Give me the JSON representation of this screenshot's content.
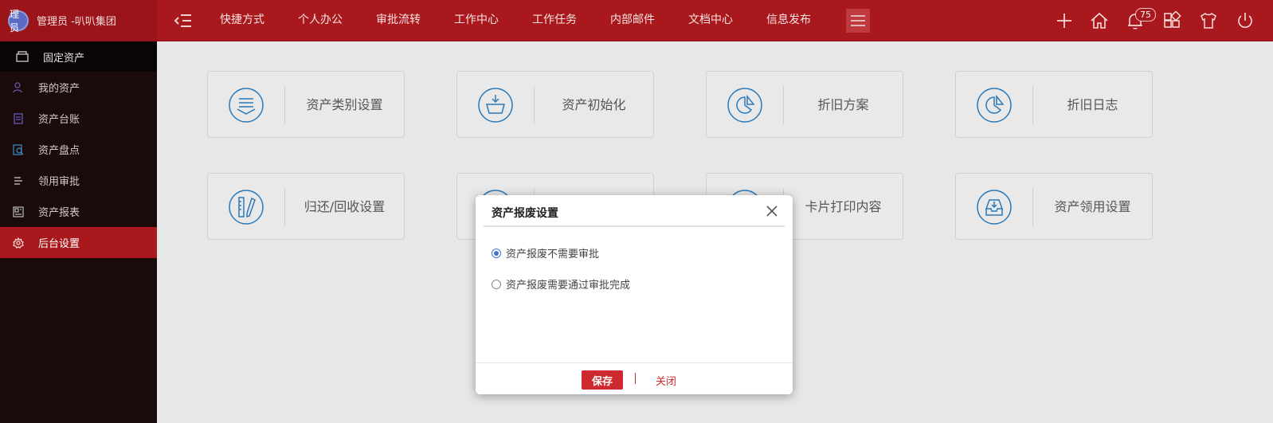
{
  "header": {
    "avatar_text": "理员",
    "brand": "管理员 -叭叭集团",
    "nav": [
      "快捷方式",
      "个人办公",
      "审批流转",
      "工作中心",
      "工作任务",
      "内部邮件",
      "文档中心",
      "信息发布"
    ],
    "notification_count": "75",
    "accent": "#a8181d"
  },
  "sidebar": {
    "module_title": "固定资产",
    "items": [
      {
        "label": "我的资产",
        "icon": "user-icon"
      },
      {
        "label": "资产台账",
        "icon": "ledger-icon"
      },
      {
        "label": "资产盘点",
        "icon": "inventory-icon"
      },
      {
        "label": "领用审批",
        "icon": "approval-icon"
      },
      {
        "label": "资产报表",
        "icon": "report-icon"
      },
      {
        "label": "后台设置",
        "icon": "gear-icon",
        "active": true
      }
    ]
  },
  "cards": [
    {
      "label": "资产类别设置",
      "icon": "category-icon"
    },
    {
      "label": "资产初始化",
      "icon": "basket-icon"
    },
    {
      "label": "折旧方案",
      "icon": "pie-icon"
    },
    {
      "label": "折旧日志",
      "icon": "pie-icon"
    },
    {
      "label": "归还/回收设置",
      "icon": "ruler-pencil-icon"
    },
    {
      "label": "",
      "icon": "hidden-icon"
    },
    {
      "label": "卡片打印内容",
      "icon": "print-icon"
    },
    {
      "label": "资产领用设置",
      "icon": "inbox-icon"
    }
  ],
  "dialog": {
    "title": "资产报废设置",
    "options": [
      {
        "label": "资产报废不需要审批",
        "checked": true
      },
      {
        "label": "资产报废需要通过审批完成",
        "checked": false
      }
    ],
    "save_label": "保存",
    "close_label": "关闭"
  }
}
